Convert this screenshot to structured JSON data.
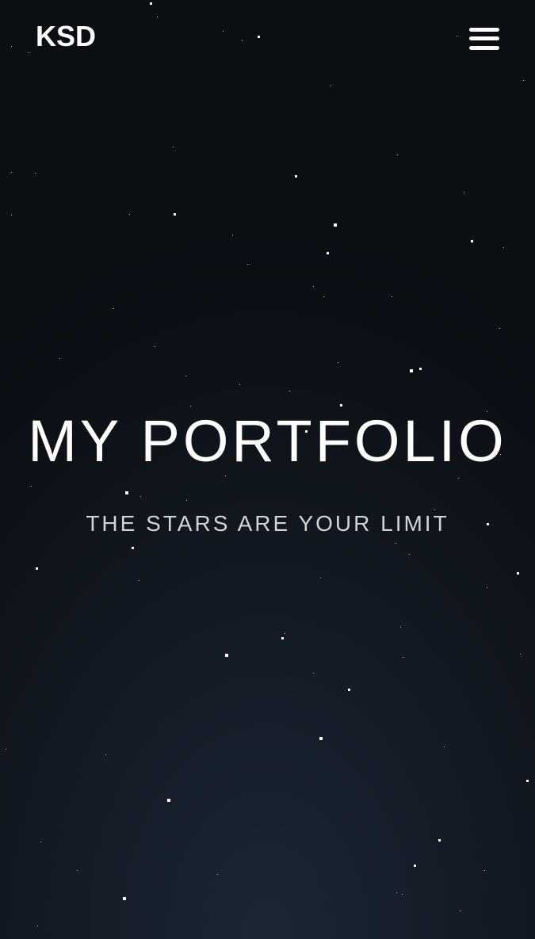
{
  "header": {
    "logo_text": "KSD",
    "menu_icon": "hamburger-menu-icon"
  },
  "hero": {
    "title": "MY PORTFOLIO",
    "subtitle": "THE STARS ARE YOUR LIMIT"
  },
  "colors": {
    "background_dark": "#0b0e13",
    "background_glow": "#1b2735",
    "text_primary": "#ffffff",
    "text_secondary": "#d0d3d8",
    "star": "#ffffff"
  }
}
